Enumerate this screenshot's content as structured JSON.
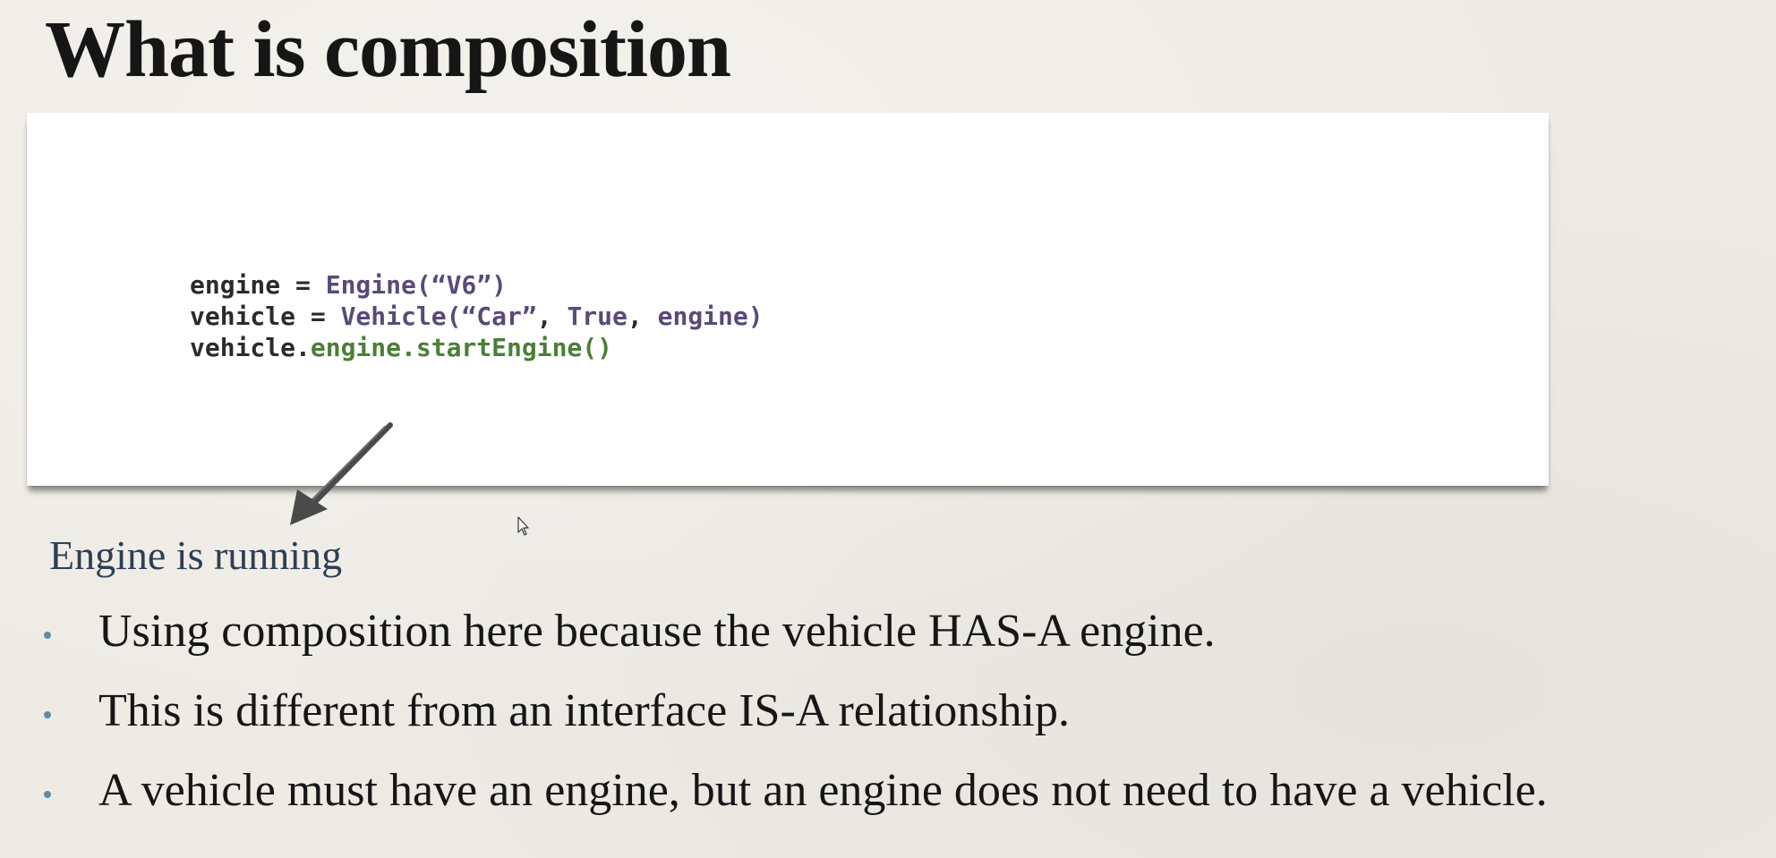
{
  "slide": {
    "title": "What is composition"
  },
  "code": {
    "lines": [
      [
        {
          "text": "engine = ",
          "style": "plain"
        },
        {
          "text": "Engine(“V6”)",
          "style": "purple"
        }
      ],
      [
        {
          "text": "vehicle = ",
          "style": "plain"
        },
        {
          "text": "Vehicle(“Car”",
          "style": "purple"
        },
        {
          "text": ", ",
          "style": "plain"
        },
        {
          "text": "True",
          "style": "purple"
        },
        {
          "text": ", ",
          "style": "plain"
        },
        {
          "text": "engine",
          "style": "purple"
        },
        {
          "text": ")",
          "style": "purple"
        }
      ],
      [
        {
          "text": "vehicle.",
          "style": "plain"
        },
        {
          "text": "engine.startEngine()",
          "style": "green"
        }
      ]
    ],
    "colors": {
      "plain": "#2b2b2b",
      "purple": "#5a4a7a",
      "green": "#4a7f36"
    }
  },
  "output": {
    "text": "Engine is running"
  },
  "bullets": [
    {
      "text": "Using composition here because the vehicle HAS-A engine."
    },
    {
      "text": "This is different from an interface IS-A relationship."
    },
    {
      "text": "A vehicle must have an engine, but an engine does not need to have a vehicle."
    }
  ],
  "icons": {
    "arrow": "arrow-down-left-icon",
    "cursor": "mouse-pointer-icon"
  }
}
